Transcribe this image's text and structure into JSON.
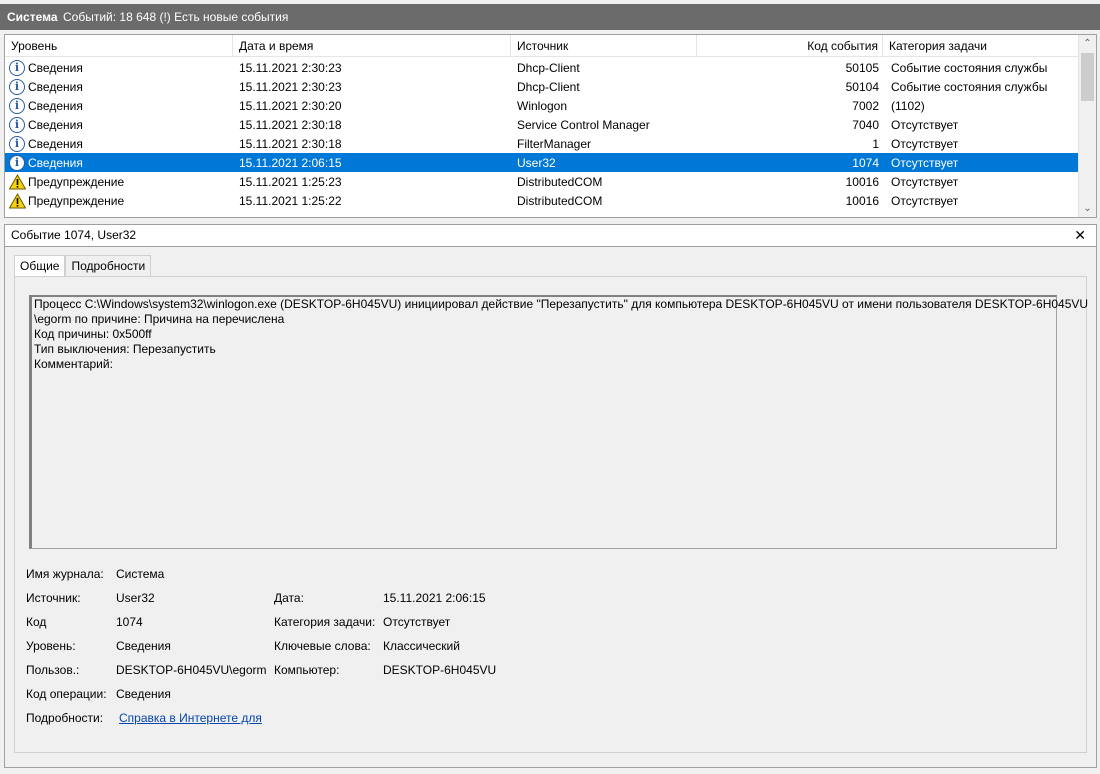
{
  "titlebar": {
    "log_name": "Система",
    "event_count": "Событий: 18 648 (!) Есть новые события"
  },
  "grid": {
    "columns": [
      "Уровень",
      "Дата и время",
      "Источник",
      "Код события",
      "Категория задачи"
    ],
    "rows": [
      {
        "icon": "info-icon",
        "level": "Сведения",
        "date": "15.11.2021 2:30:23",
        "source": "Dhcp-Client",
        "code": "50105",
        "category": "Событие состояния службы"
      },
      {
        "icon": "info-icon",
        "level": "Сведения",
        "date": "15.11.2021 2:30:23",
        "source": "Dhcp-Client",
        "code": "50104",
        "category": "Событие состояния службы"
      },
      {
        "icon": "info-icon",
        "level": "Сведения",
        "date": "15.11.2021 2:30:20",
        "source": "Winlogon",
        "code": "7002",
        "category": "(1102)"
      },
      {
        "icon": "info-icon",
        "level": "Сведения",
        "date": "15.11.2021 2:30:18",
        "source": "Service Control Manager",
        "code": "7040",
        "category": "Отсутствует"
      },
      {
        "icon": "info-icon",
        "level": "Сведения",
        "date": "15.11.2021 2:30:18",
        "source": "FilterManager",
        "code": "1",
        "category": "Отсутствует"
      },
      {
        "icon": "info-icon",
        "level": "Сведения",
        "date": "15.11.2021 2:06:15",
        "source": "User32",
        "code": "1074",
        "category": "Отсутствует",
        "selected": true
      },
      {
        "icon": "warning-icon",
        "level": "Предупреждение",
        "date": "15.11.2021 1:25:23",
        "source": "DistributedCOM",
        "code": "10016",
        "category": "Отсутствует"
      },
      {
        "icon": "warning-icon",
        "level": "Предупреждение",
        "date": "15.11.2021 1:25:22",
        "source": "DistributedCOM",
        "code": "10016",
        "category": "Отсутствует"
      }
    ]
  },
  "detail": {
    "title": "Событие 1074, User32",
    "tabs": [
      "Общие",
      "Подробности"
    ],
    "message_lines": [
      "Процесс C:\\Windows\\system32\\winlogon.exe (DESKTOP-6H045VU) инициировал действие \"Перезапустить\" для компьютера DESKTOP-6H045VU от имени пользователя DESKTOP-6H045VU",
      "\\egorm по причине: Причина на перечислена",
      " Код причины: 0x500ff",
      " Тип выключения: Перезапустить",
      " Комментарий:"
    ],
    "props": {
      "log_label": "Имя журнала:",
      "log_value": "Система",
      "source_label": "Источник:",
      "source_value": "User32",
      "date_label": "Дата:",
      "date_value": "15.11.2021 2:06:15",
      "code_label": "Код",
      "code_value": "1074",
      "category_label": "Категория задачи:",
      "category_value": "Отсутствует",
      "level_label": "Уровень:",
      "level_value": "Сведения",
      "keywords_label": "Ключевые слова:",
      "keywords_value": "Классический",
      "user_label": "Пользов.:",
      "user_value": "DESKTOP-6H045VU\\egorm",
      "computer_label": "Компьютер:",
      "computer_value": "DESKTOP-6H045VU",
      "opcode_label": "Код операции:",
      "opcode_value": "Сведения",
      "more_label": "Подробности:",
      "more_link": "Справка в Интернете для"
    }
  },
  "colors": {
    "selected_row": "#0078d7",
    "titlebar": "#6b6b6b",
    "link": "#0645ad"
  }
}
